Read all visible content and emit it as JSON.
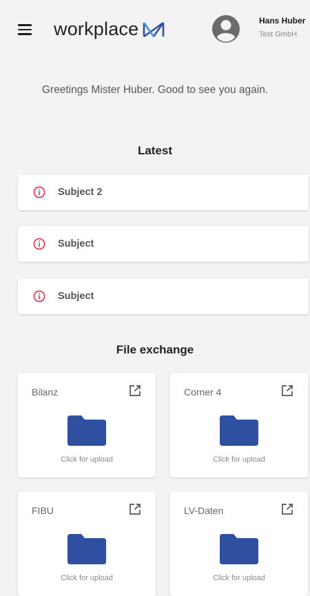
{
  "header": {
    "logo_text": "workplace",
    "user_name": "Hans Huber",
    "user_company": "Test GmbH"
  },
  "greeting": "Greetings Mister Huber. Good to see you again.",
  "latest": {
    "title": "Latest",
    "items": [
      {
        "label": "Subject 2"
      },
      {
        "label": "Subject"
      },
      {
        "label": "Subject"
      }
    ]
  },
  "file_exchange": {
    "title": "File exchange",
    "cards": [
      {
        "name": "Bilanz",
        "upload_label": "Click for upload"
      },
      {
        "name": "Corner 4",
        "upload_label": "Click for upload"
      },
      {
        "name": "FIBU",
        "upload_label": "Click for upload"
      },
      {
        "name": "LV-Daten",
        "upload_label": "Click for upload"
      }
    ]
  },
  "colors": {
    "accent_blue": "#2f4fa0",
    "alert_red": "#d9364f",
    "background": "#f3f3f3"
  },
  "icons": {
    "menu": "hamburger-menu-icon",
    "avatar": "account-circle-icon",
    "alert": "info-circle-icon",
    "open": "open-in-new-icon",
    "folder": "folder-icon"
  }
}
